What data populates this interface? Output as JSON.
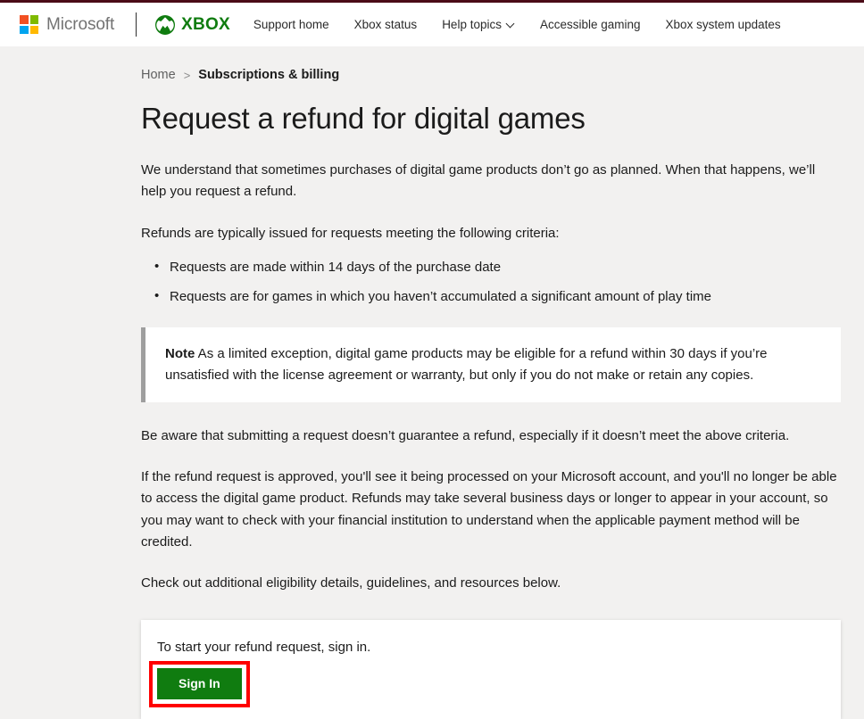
{
  "theme": {
    "accent_bar": "#4b0c17",
    "page_background": "#f2f1f0",
    "xbox_green": "#107c10",
    "highlight_red": "#ff0000",
    "note_bar": "#9e9e9e"
  },
  "header": {
    "microsoft_wordmark": "Microsoft",
    "xbox_wordmark": "XBOX",
    "nav_items": [
      {
        "label": "Support home",
        "has_chevron": false
      },
      {
        "label": "Xbox status",
        "has_chevron": false
      },
      {
        "label": "Help topics",
        "has_chevron": true
      },
      {
        "label": "Accessible gaming",
        "has_chevron": false
      },
      {
        "label": "Xbox system updates",
        "has_chevron": false
      }
    ]
  },
  "breadcrumb": {
    "home": "Home",
    "separator": ">",
    "current": "Subscriptions & billing"
  },
  "main": {
    "title": "Request a refund for digital games",
    "intro": "We understand that sometimes purchases of digital game products don’t go as planned. When that happens, we’ll help you request a refund.",
    "criteria_lead": "Refunds are typically issued for requests meeting the following criteria:",
    "criteria": [
      "Requests are made within 14 days of the purchase date",
      "Requests are for games in which you haven’t accumulated a significant amount of play time"
    ],
    "note": {
      "label": "Note",
      "body": " As a limited exception, digital game products may be eligible for a refund within 30 days if you’re unsatisfied with the license agreement or warranty, but only if you do not make or retain any copies."
    },
    "paragraph_guarantee": "Be aware that submitting a request doesn’t guarantee a refund, especially if it doesn’t meet the above criteria.",
    "paragraph_approved": "If the refund request is approved, you'll see it being processed on your Microsoft account, and you'll no longer be able to access the digital game product. Refunds may take several business days or longer to appear in your account, so you may want to check with your financial institution to understand when the applicable payment method will be credited.",
    "paragraph_resources": "Check out additional eligibility details, guidelines, and resources below."
  },
  "signin_card": {
    "prompt": "To start your refund request, sign in.",
    "button_label": "Sign In"
  }
}
